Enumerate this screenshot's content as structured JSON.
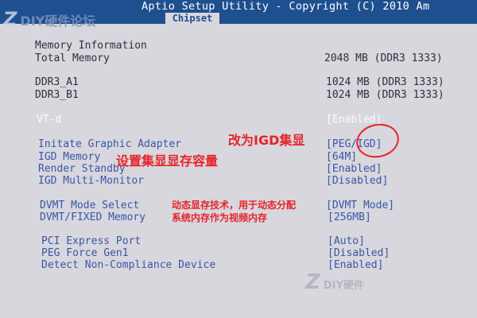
{
  "header": {
    "title": "Aptio Setup Utility - Copyright (C) 2010 Am",
    "tab": "Chipset"
  },
  "watermark": {
    "top_text": "DIY硬件论坛",
    "bottom_text": "DIY硬件"
  },
  "memory": {
    "heading": "Memory Information",
    "total_label": "Total Memory",
    "total_value": "2048 MB (DDR3 1333)",
    "a1_label": "DDR3_A1",
    "a1_value": "1024 MB (DDR3 1333)",
    "b1_label": "DDR3_B1",
    "b1_value": "1024 MB (DDR3 1333)"
  },
  "settings": [
    {
      "label": "VT-d",
      "value": "[Enabled]"
    },
    {
      "label": "Initate Graphic Adapter",
      "value": "[PEG/IGD]"
    },
    {
      "label": "IGD Memory",
      "value": "[64M]"
    },
    {
      "label": "Render Standby",
      "value": "[Enabled]"
    },
    {
      "label": "IGD Multi-Monitor",
      "value": "[Disabled]"
    },
    {
      "label": "DVMT Mode Select",
      "value": "[DVMT Mode]"
    },
    {
      "label": "DVMT/FIXED Memory",
      "value": "[256MB]"
    },
    {
      "label": "PCI Express Port",
      "value": "[Auto]"
    },
    {
      "label": "PEG Force Gen1",
      "value": "[Disabled]"
    },
    {
      "label": "Detect Non-Compliance Device",
      "value": "[Enabled]"
    }
  ],
  "annotations": {
    "igd": "改为IGD集显",
    "memory_size": "设置集显显存容量",
    "dvmt_line1": "动态显存技术，用于动态分配",
    "dvmt_line2": "系统内存作为视频内存"
  },
  "colors": {
    "header_blue": "#1e4f8f",
    "option_blue": "#3c55a9",
    "annotation_red": "#e6232b",
    "background": "#d7d7dd"
  }
}
